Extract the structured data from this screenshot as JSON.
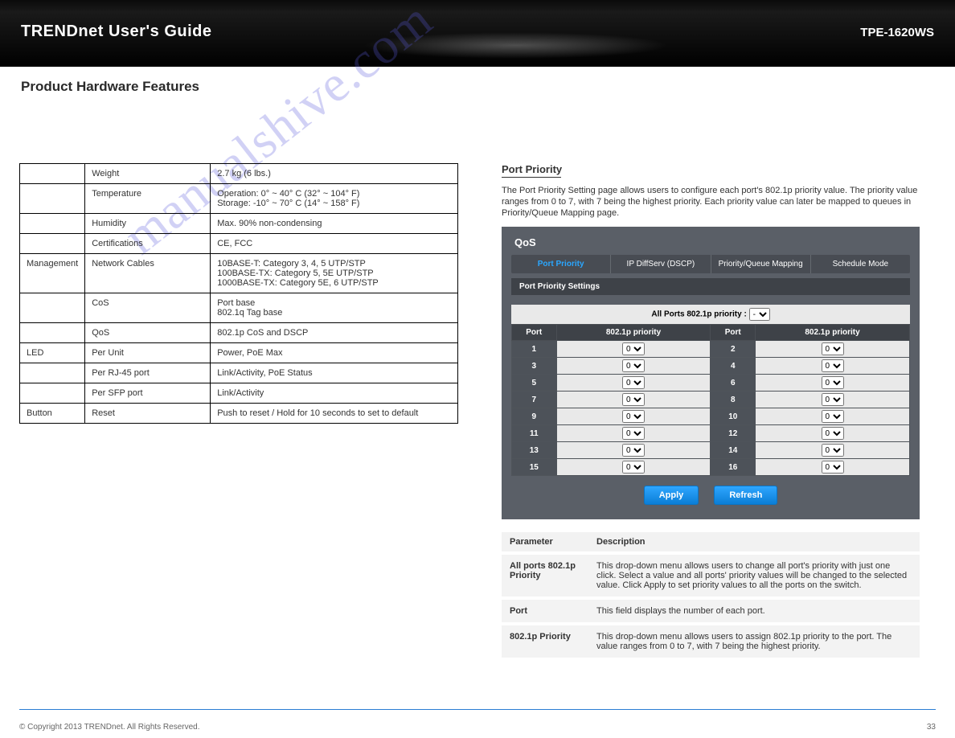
{
  "topbar": {
    "brand": "TRENDnet User's Guide",
    "model": "TPE-1620WS"
  },
  "sectionTitle": "Product Hardware Features",
  "watermark": "manualshive.com",
  "specs": [
    {
      "group": "",
      "label": "Weight",
      "value": "2.7 kg (6 lbs.)"
    },
    {
      "group": "",
      "label": "Temperature",
      "value": "Operation: 0° ~ 40° C (32° ~ 104° F)\nStorage: -10° ~ 70° C (14° ~ 158° F)"
    },
    {
      "group": "",
      "label": "Humidity",
      "value": "Max. 90% non-condensing"
    },
    {
      "group": "",
      "label": "Certifications",
      "value": "CE, FCC"
    },
    {
      "group": "Management",
      "label": "Network Cables",
      "value": "10BASE-T: Category 3, 4, 5 UTP/STP\n100BASE-TX: Category 5, 5E UTP/STP\n1000BASE-TX: Category 5E, 6 UTP/STP"
    },
    {
      "group": "",
      "label": "CoS",
      "value": "Port base\n802.1q Tag base"
    },
    {
      "group": "",
      "label": "QoS",
      "value": "802.1p CoS and DSCP"
    },
    {
      "group": "LED",
      "label": "Per Unit",
      "value": "Power, PoE Max"
    },
    {
      "group": "",
      "label": "Per RJ-45 port",
      "value": "Link/Activity, PoE Status"
    },
    {
      "group": "",
      "label": "Per SFP port",
      "value": "Link/Activity"
    },
    {
      "group": "Button",
      "label": "Reset",
      "value": "Push to reset / Hold for 10 seconds to set to default"
    }
  ],
  "rightHeading": "Port Priority",
  "rightText": "The Port Priority Setting page allows users to configure each port's 802.1p priority value. The priority value ranges from 0 to 7, with 7 being the highest priority. Each priority value can later be mapped to queues in Priority/Queue Mapping page.",
  "qos": {
    "title": "QoS",
    "tabs": [
      "Port Priority",
      "IP DiffServ (DSCP)",
      "Priority/Queue Mapping",
      "Schedule Mode"
    ],
    "subheader": "Port Priority Settings",
    "allPortsLabel": "All Ports 802.1p priority :",
    "allPortsValue": "-",
    "headers": {
      "port": "Port",
      "pri": "802.1p priority"
    },
    "ports": [
      {
        "n": 1,
        "v": "0"
      },
      {
        "n": 2,
        "v": "0"
      },
      {
        "n": 3,
        "v": "0"
      },
      {
        "n": 4,
        "v": "0"
      },
      {
        "n": 5,
        "v": "0"
      },
      {
        "n": 6,
        "v": "0"
      },
      {
        "n": 7,
        "v": "0"
      },
      {
        "n": 8,
        "v": "0"
      },
      {
        "n": 9,
        "v": "0"
      },
      {
        "n": 10,
        "v": "0"
      },
      {
        "n": 11,
        "v": "0"
      },
      {
        "n": 12,
        "v": "0"
      },
      {
        "n": 13,
        "v": "0"
      },
      {
        "n": 14,
        "v": "0"
      },
      {
        "n": 15,
        "v": "0"
      },
      {
        "n": 16,
        "v": "0"
      }
    ],
    "applyBtn": "Apply",
    "refreshBtn": "Refresh"
  },
  "desc": {
    "h1": "Parameter",
    "h2": "Description",
    "rows": [
      {
        "p": "All ports 802.1p Priority",
        "d": "This drop-down menu allows users to change all port's priority with just one click. Select a value and all ports' priority values will be changed to the selected value. Click Apply to set priority values to all the ports on the switch."
      },
      {
        "p": "Port",
        "d": "This field displays the number of each port."
      },
      {
        "p": "802.1p Priority",
        "d": "This drop-down menu allows users to assign 802.1p priority to the port. The value ranges from 0 to 7, with 7 being the highest priority."
      }
    ]
  },
  "footer": {
    "copy": "© Copyright 2013 TRENDnet. All Rights Reserved.",
    "page": "33"
  }
}
